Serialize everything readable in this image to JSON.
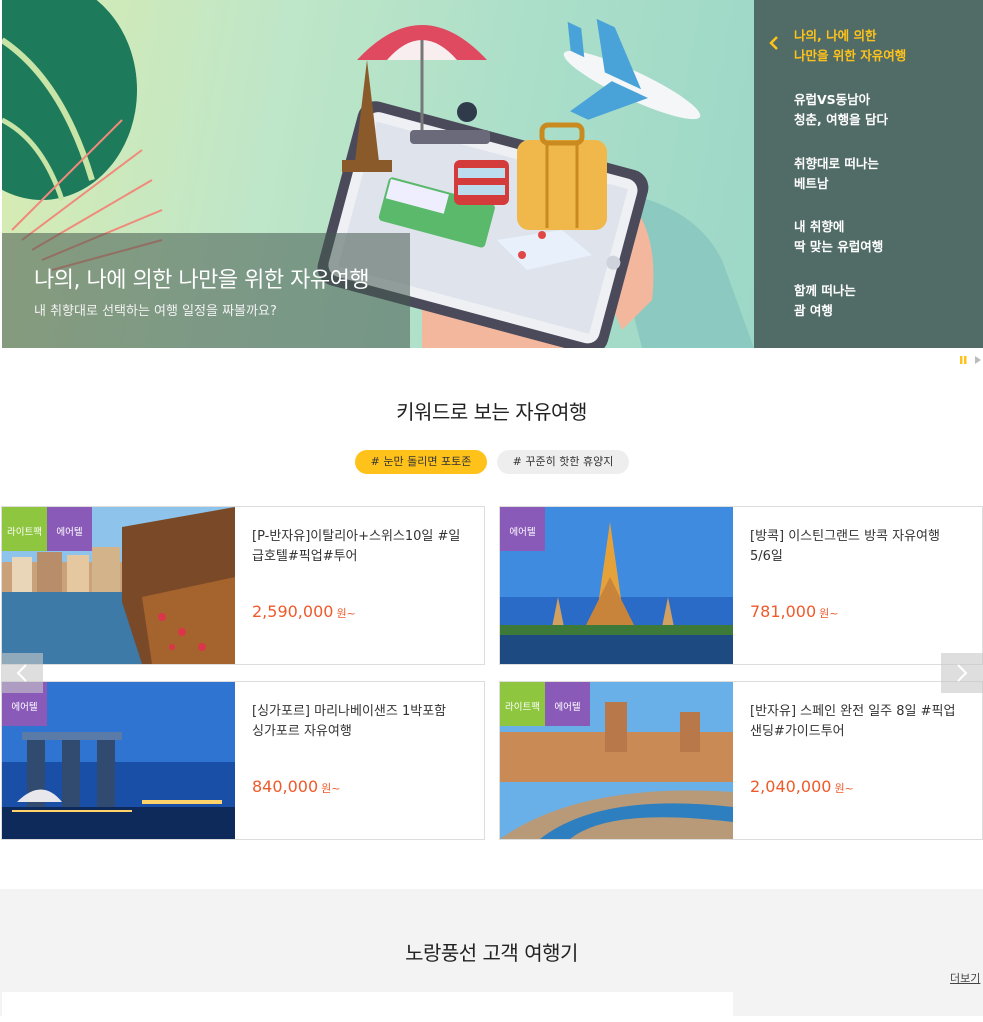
{
  "hero": {
    "title": "나의, 나에 의한 나만을 위한 자유여행",
    "subtitle": "내 취향대로 선택하는 여행 일정을 짜볼까요?",
    "menu": [
      {
        "line1": "나의, 나에 의한",
        "line2": "나만을 위한 자유여행",
        "active": true
      },
      {
        "line1": "유럽VS동남아",
        "line2": "청춘, 여행을 담다",
        "active": false
      },
      {
        "line1": "취향대로 떠나는",
        "line2": "베트남",
        "active": false
      },
      {
        "line1": "내 취향에",
        "line2": "딱 맞는 유럽여행",
        "active": false
      },
      {
        "line1": "함께 떠나는",
        "line2": "괌 여행",
        "active": false
      }
    ]
  },
  "keyword": {
    "title": "키워드로 보는 자유여행",
    "tags": [
      "# 눈만 돌리면 포토존",
      "# 꾸준히 핫한 휴양지"
    ]
  },
  "products": [
    {
      "badges": [
        "라이트팩",
        "에어텔"
      ],
      "name": "[P-반자유]이탈리아+스위스10일 #일급호텔#픽업#투어",
      "price": "2,590,000",
      "unit": "원~"
    },
    {
      "badges": [
        "에어텔"
      ],
      "name": "[방콕] 이스틴그랜드 방콕 자유여행 5/6일",
      "price": "781,000",
      "unit": "원~"
    },
    {
      "badges": [
        "에어텔"
      ],
      "name": "[싱가포르] 마리나베이샌즈 1박포함 싱가포르 자유여행",
      "price": "840,000",
      "unit": "원~"
    },
    {
      "badges": [
        "라이트팩",
        "에어텔"
      ],
      "name": "[반자유] 스페인 완전 일주 8일 #픽업샌딩#가이드투어",
      "price": "2,040,000",
      "unit": "원~"
    }
  ],
  "reviews": {
    "title": "노랑풍선 고객 여행기",
    "more": "더보기"
  },
  "colors": {
    "accent": "#ffc21a",
    "price": "#ee5a2b",
    "badge_light": "#8ec63f",
    "badge_air": "#8a5ab9"
  }
}
